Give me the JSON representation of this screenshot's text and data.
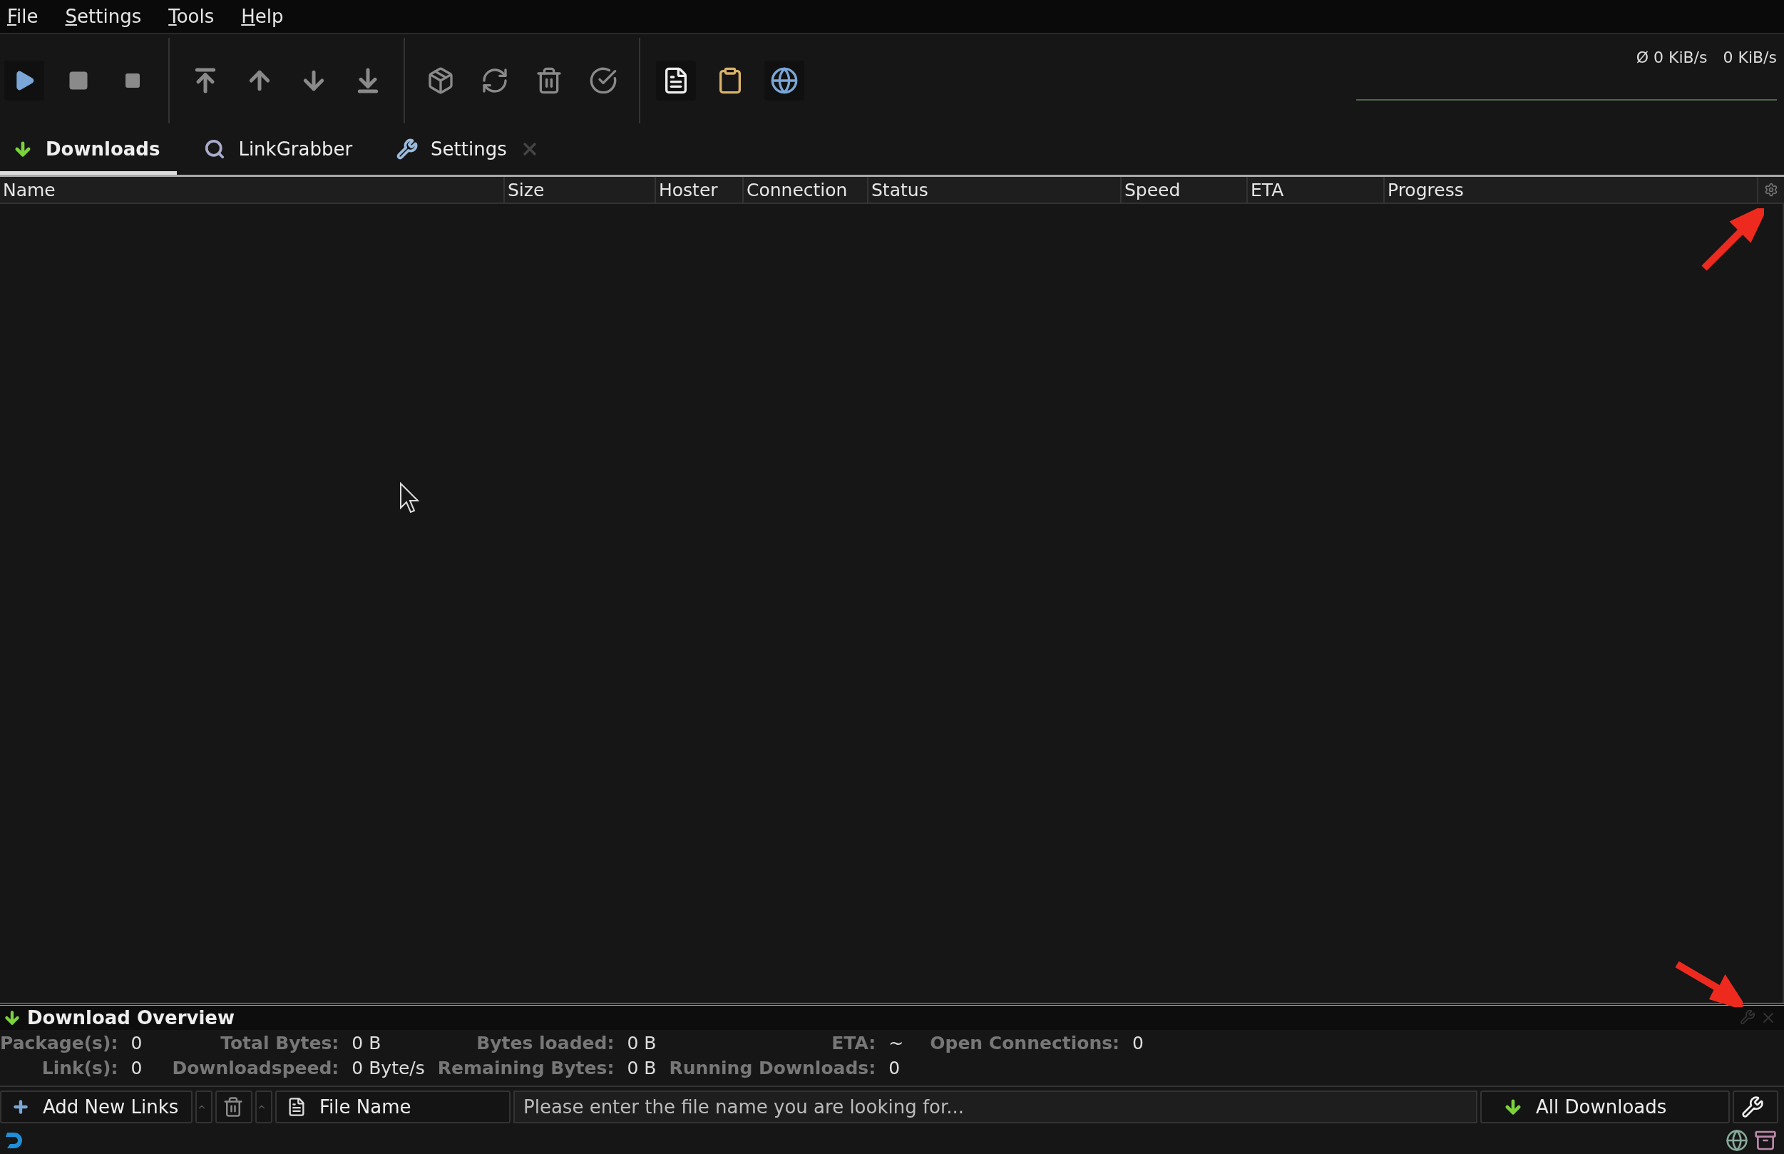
{
  "menu": [
    "File",
    "Settings",
    "Tools",
    "Help"
  ],
  "speed": {
    "average": "Ø 0 KiB/s",
    "current": "0 KiB/s"
  },
  "tabs": [
    {
      "label": "Downloads",
      "kind": "downloads",
      "selected": true,
      "closable": false
    },
    {
      "label": "LinkGrabber",
      "kind": "linkgrabber",
      "selected": false,
      "closable": false
    },
    {
      "label": "Settings",
      "kind": "settings",
      "selected": false,
      "closable": true
    }
  ],
  "table": {
    "columns": [
      "Name",
      "Size",
      "Hoster",
      "Connection",
      "Status",
      "Speed",
      "ETA",
      "Progress"
    ]
  },
  "overview": {
    "title": "Download Overview",
    "rows": [
      [
        {
          "label": "Package(s):",
          "value": "0"
        },
        {
          "label": "Total Bytes:",
          "value": "0 B"
        },
        {
          "label": "Bytes loaded:",
          "value": "0 B"
        },
        {
          "label": "ETA:",
          "value": "~"
        },
        {
          "label": "Open Connections:",
          "value": "0"
        }
      ],
      [
        {
          "label": "Link(s):",
          "value": "0"
        },
        {
          "label": "Downloadspeed:",
          "value": "0 Byte/s"
        },
        {
          "label": "Remaining Bytes:",
          "value": "0 B"
        },
        {
          "label": "Running Downloads:",
          "value": "0"
        }
      ]
    ]
  },
  "bottom_bar": {
    "add_button": "Add New Links",
    "search_by": "File Name",
    "search": {
      "placeholder": "Please enter the file name you are looking for..."
    },
    "view_filter": "All Downloads"
  }
}
